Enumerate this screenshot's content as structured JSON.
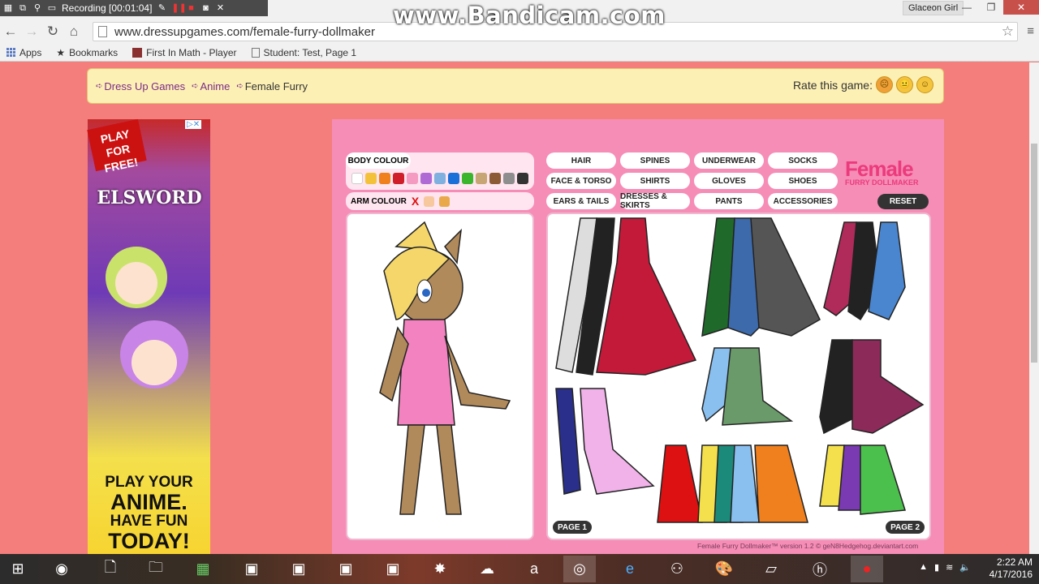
{
  "recorder": {
    "status": "Recording [00:01:04]"
  },
  "watermark": "www.Bandicam.com",
  "window": {
    "user": "Glaceon Girl"
  },
  "browser": {
    "url": "www.dressupgames.com/female-furry-dollmaker",
    "bookmarks": [
      "Apps",
      "Bookmarks",
      "First In Math - Player",
      "Student: Test, Page 1"
    ]
  },
  "breadcrumb": {
    "items": [
      "Dress Up Games",
      "Anime"
    ],
    "current": "Female Furry"
  },
  "rate": {
    "label": "Rate this game:"
  },
  "ad": {
    "badge": "PLAY FOR FREE!",
    "logo": "ELSWORD",
    "line1": "PLAY YOUR",
    "line2": "ANIME.",
    "line3": "HAVE FUN",
    "line4": "TODAY!"
  },
  "game": {
    "body_colour_label": "BODY COLOUR",
    "arm_colour_label": "ARM COLOUR",
    "arm_clear": "X",
    "body_swatches": [
      "#ffffff",
      "#f4c23a",
      "#f07f1e",
      "#d01f2a",
      "#f59ac1",
      "#b06ad6",
      "#7fb0e0",
      "#1a6fd8",
      "#3bb62c",
      "#c8a574",
      "#8c5a34",
      "#8e8e8e",
      "#333333"
    ],
    "arm_swatches": [
      "#f7c79e",
      "#e9a94a"
    ],
    "categories": [
      "HAIR",
      "SPINES",
      "UNDERWEAR",
      "SOCKS",
      "FACE & TORSO",
      "SHIRTS",
      "GLOVES",
      "SHOES",
      "EARS & TAILS",
      "DRESSES & SKIRTS",
      "PANTS",
      "ACCESSORIES"
    ],
    "reset": "RESET",
    "logo_main": "Female",
    "logo_sub": "FURRY DOLLMAKER",
    "page1": "PAGE 1",
    "page2": "PAGE 2",
    "credit": "Female Furry Dollmaker™ version 1.2 © geN8Hedgehog.deviantart.com"
  },
  "clock": {
    "time": "2:22 AM",
    "date": "4/17/2016"
  }
}
